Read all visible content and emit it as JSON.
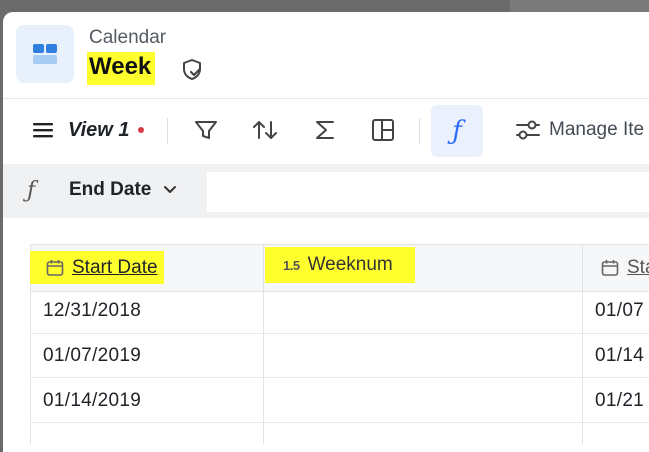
{
  "header": {
    "breadcrumb": "Calendar",
    "view_title": "Week"
  },
  "toolbar": {
    "view_name": "View 1",
    "manage_label": "Manage Ite"
  },
  "formula_bar": {
    "field_name": "End Date"
  },
  "table": {
    "columns": [
      {
        "label": "Start Date",
        "type_icon": "calendar-icon"
      },
      {
        "label": "Weeknum",
        "type_icon": "1.5"
      },
      {
        "label": "Sta",
        "type_icon": "calendar-icon"
      }
    ],
    "rows": [
      [
        "12/31/2018",
        "",
        "01/07"
      ],
      [
        "01/07/2019",
        "",
        "01/14"
      ],
      [
        "01/14/2019",
        "",
        "01/21"
      ]
    ]
  },
  "colors": {
    "highlight": "#ffff2e",
    "accent": "#2f6bff",
    "unsaved_dot": "#d93a48"
  }
}
